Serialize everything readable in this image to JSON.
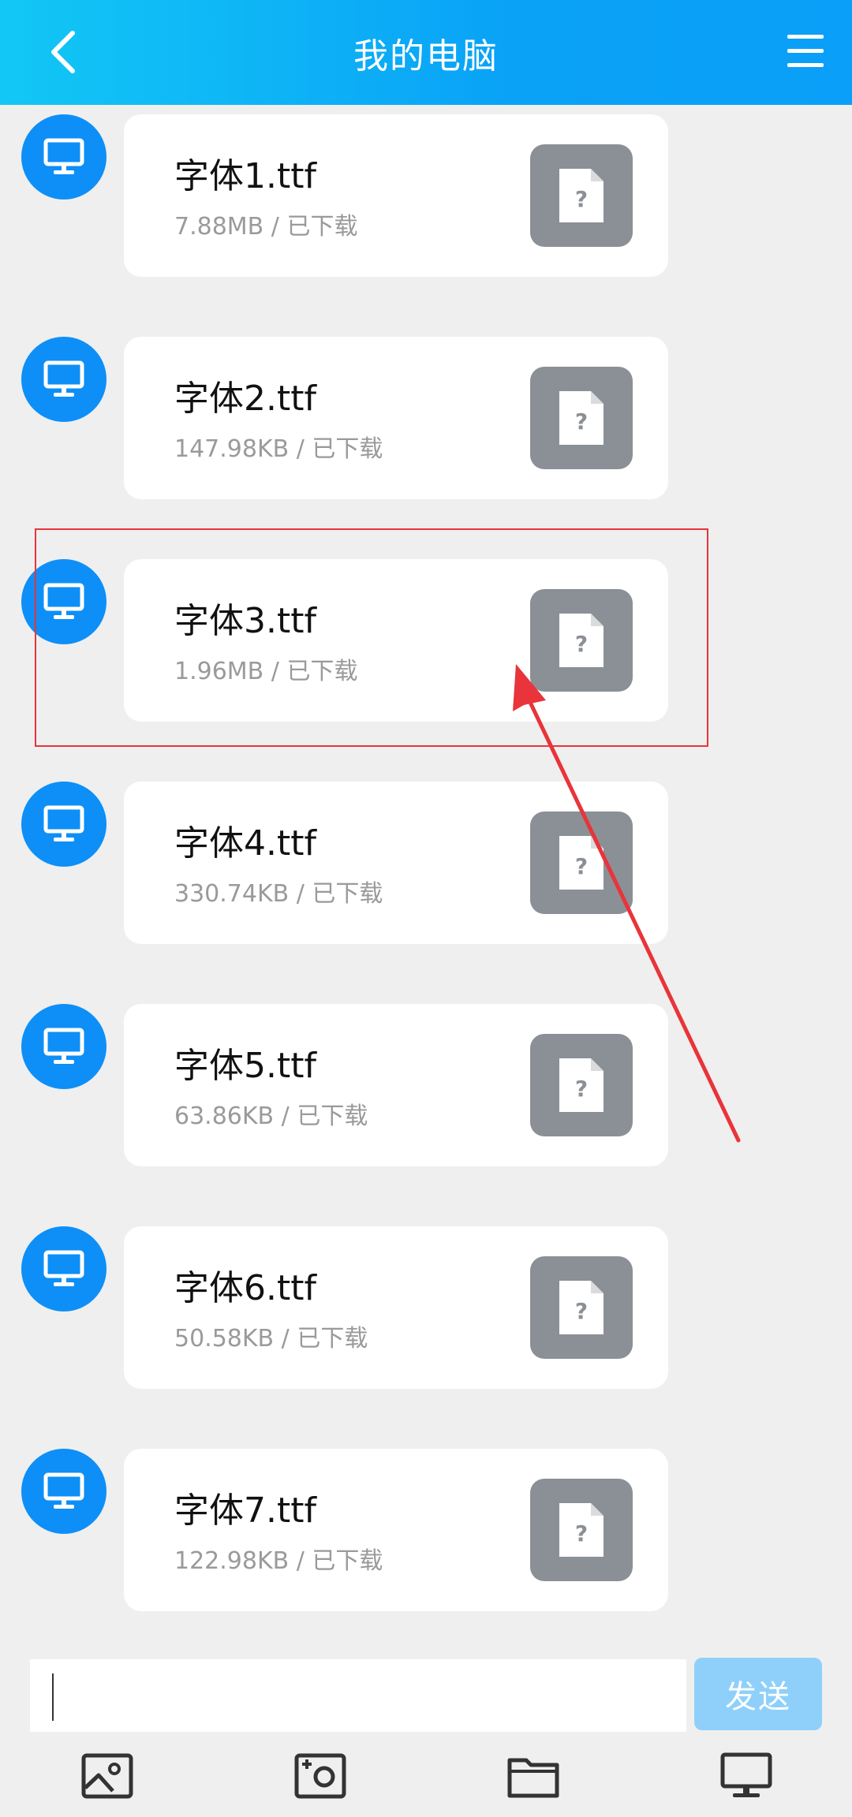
{
  "header": {
    "title": "我的电脑"
  },
  "files": [
    {
      "name": "字体1.ttf",
      "meta": "7.88MB / 已下载"
    },
    {
      "name": "字体2.ttf",
      "meta": "147.98KB / 已下载"
    },
    {
      "name": "字体3.ttf",
      "meta": "1.96MB / 已下载"
    },
    {
      "name": "字体4.ttf",
      "meta": "330.74KB / 已下载"
    },
    {
      "name": "字体5.ttf",
      "meta": "63.86KB / 已下载"
    },
    {
      "name": "字体6.ttf",
      "meta": "50.58KB / 已下载"
    },
    {
      "name": "字体7.ttf",
      "meta": "122.98KB / 已下载"
    }
  ],
  "icons": {
    "back": "chevron-left-icon",
    "menu": "hamburger-menu-icon",
    "avatar": "computer-monitor-icon",
    "file": "unknown-file-icon",
    "tools": [
      "image-icon",
      "camera-icon",
      "folder-icon",
      "computer-icon"
    ]
  },
  "composer": {
    "input_value": "",
    "send_label": "发送"
  },
  "colors": {
    "header_start": "#12c7f5",
    "header_end": "#0a9ff8",
    "avatar": "#0d8ff7",
    "file_icon": "#8b9096",
    "send_button": "#8fd0fb",
    "annotation": "#e8343a"
  }
}
